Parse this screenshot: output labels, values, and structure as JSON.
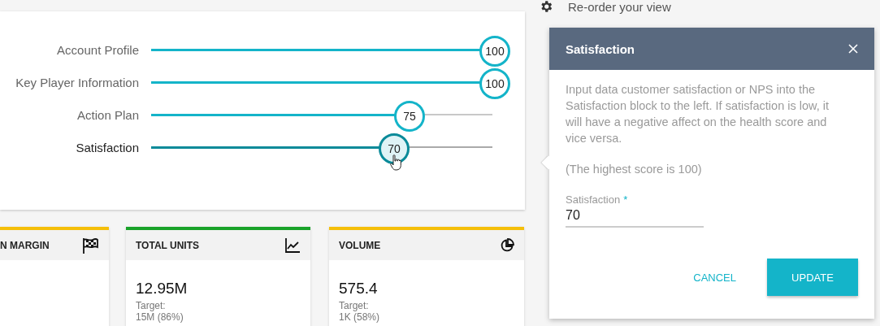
{
  "sliders": [
    {
      "label": "Account Profile",
      "level": 1,
      "value": "100",
      "selected": false
    },
    {
      "label": "Key Player Information",
      "level": 1,
      "value": "100",
      "selected": false
    },
    {
      "label": "Action Plan",
      "level": 0.75,
      "value": "75",
      "selected": false
    },
    {
      "label": "Satisfaction",
      "level": 0.7,
      "value": "70",
      "selected": true
    }
  ],
  "cards": [
    {
      "title": "N MARGIN",
      "color": "#f5bf0a",
      "kind": "flag"
    },
    {
      "title": "TOTAL UNITS",
      "color": "#1aa32a",
      "kind": "chart",
      "value": "12.95M",
      "target_label": "Target:",
      "target": "15M (86%)"
    },
    {
      "title": "VOLUME",
      "color": "#f5bf0a",
      "kind": "pie",
      "value": "575.4",
      "target_label": "Target:",
      "target": "1K (58%)"
    }
  ],
  "reorder": {
    "label": "Re-order your view"
  },
  "popover": {
    "title": "Satisfaction",
    "description": "Input data customer satisfaction or NPS into the Satisfaction block to the left. If satisfaction is low, it will have a negative affect on the health score and vice versa.",
    "note": "(The highest score is 100)",
    "field": {
      "label": "Satisfaction",
      "required_mark": "*",
      "value": "70"
    },
    "buttons": [
      {
        "label": "CANCEL",
        "kind": "text"
      },
      {
        "label": "UPDATE",
        "kind": "primary"
      }
    ]
  }
}
